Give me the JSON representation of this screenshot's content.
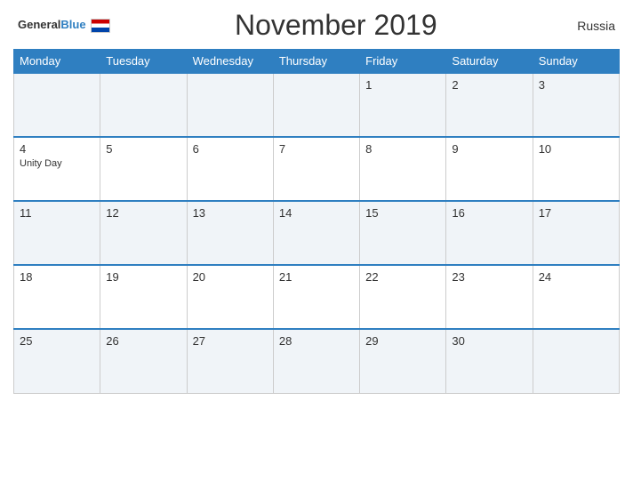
{
  "header": {
    "title": "November 2019",
    "country": "Russia",
    "logo": {
      "general": "General",
      "blue": "Blue"
    }
  },
  "days_of_week": [
    "Monday",
    "Tuesday",
    "Wednesday",
    "Thursday",
    "Friday",
    "Saturday",
    "Sunday"
  ],
  "weeks": [
    [
      {
        "day": "",
        "event": ""
      },
      {
        "day": "",
        "event": ""
      },
      {
        "day": "",
        "event": ""
      },
      {
        "day": "",
        "event": ""
      },
      {
        "day": "1",
        "event": ""
      },
      {
        "day": "2",
        "event": ""
      },
      {
        "day": "3",
        "event": ""
      }
    ],
    [
      {
        "day": "4",
        "event": "Unity Day"
      },
      {
        "day": "5",
        "event": ""
      },
      {
        "day": "6",
        "event": ""
      },
      {
        "day": "7",
        "event": ""
      },
      {
        "day": "8",
        "event": ""
      },
      {
        "day": "9",
        "event": ""
      },
      {
        "day": "10",
        "event": ""
      }
    ],
    [
      {
        "day": "11",
        "event": ""
      },
      {
        "day": "12",
        "event": ""
      },
      {
        "day": "13",
        "event": ""
      },
      {
        "day": "14",
        "event": ""
      },
      {
        "day": "15",
        "event": ""
      },
      {
        "day": "16",
        "event": ""
      },
      {
        "day": "17",
        "event": ""
      }
    ],
    [
      {
        "day": "18",
        "event": ""
      },
      {
        "day": "19",
        "event": ""
      },
      {
        "day": "20",
        "event": ""
      },
      {
        "day": "21",
        "event": ""
      },
      {
        "day": "22",
        "event": ""
      },
      {
        "day": "23",
        "event": ""
      },
      {
        "day": "24",
        "event": ""
      }
    ],
    [
      {
        "day": "25",
        "event": ""
      },
      {
        "day": "26",
        "event": ""
      },
      {
        "day": "27",
        "event": ""
      },
      {
        "day": "28",
        "event": ""
      },
      {
        "day": "29",
        "event": ""
      },
      {
        "day": "30",
        "event": ""
      },
      {
        "day": "",
        "event": ""
      }
    ]
  ],
  "colors": {
    "header_bg": "#2f7fc1",
    "row_odd": "#f0f4f8",
    "row_even": "#ffffff",
    "border_top": "#2f7fc1"
  }
}
